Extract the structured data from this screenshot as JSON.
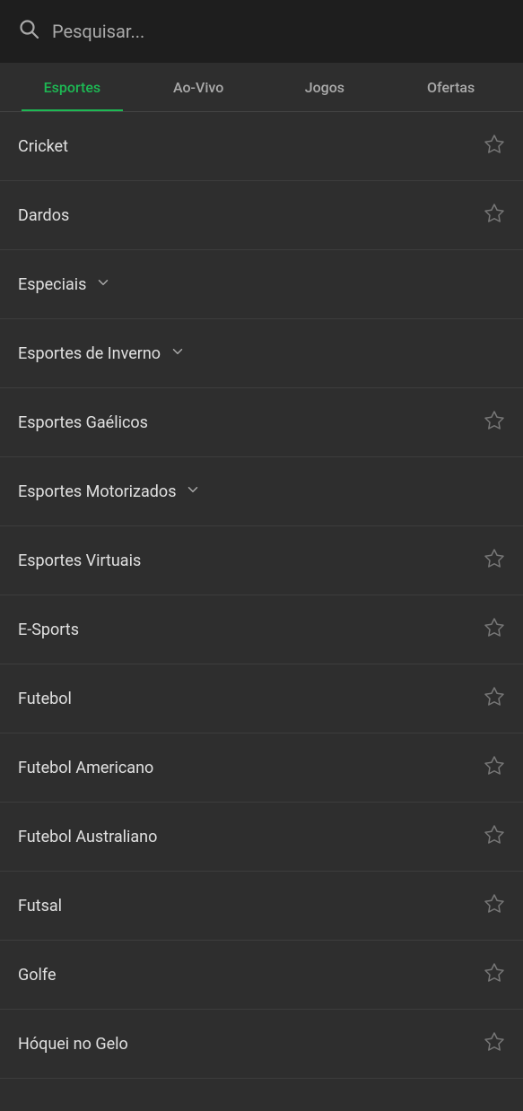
{
  "header": {
    "search_placeholder": "Pesquisar..."
  },
  "tabs": [
    {
      "id": "esportes",
      "label": "Esportes",
      "active": true
    },
    {
      "id": "ao-vivo",
      "label": "Ao-Vivo",
      "active": false
    },
    {
      "id": "jogos",
      "label": "Jogos",
      "active": false
    },
    {
      "id": "ofertas",
      "label": "Ofertas",
      "active": false
    }
  ],
  "sport_items": [
    {
      "id": "cricket",
      "label": "Cricket",
      "has_star": true,
      "has_chevron": false
    },
    {
      "id": "dardos",
      "label": "Dardos",
      "has_star": true,
      "has_chevron": false
    },
    {
      "id": "especiais",
      "label": "Especiais",
      "has_star": false,
      "has_chevron": true
    },
    {
      "id": "esportes-inverno",
      "label": "Esportes de Inverno",
      "has_star": false,
      "has_chevron": true
    },
    {
      "id": "esportes-gaelicos",
      "label": "Esportes Gaélicos",
      "has_star": true,
      "has_chevron": false
    },
    {
      "id": "esportes-motorizados",
      "label": "Esportes Motorizados",
      "has_star": false,
      "has_chevron": true
    },
    {
      "id": "esportes-virtuais",
      "label": "Esportes Virtuais",
      "has_star": true,
      "has_chevron": false
    },
    {
      "id": "e-sports",
      "label": "E-Sports",
      "has_star": true,
      "has_chevron": false
    },
    {
      "id": "futebol",
      "label": "Futebol",
      "has_star": true,
      "has_chevron": false
    },
    {
      "id": "futebol-americano",
      "label": "Futebol Americano",
      "has_star": true,
      "has_chevron": false
    },
    {
      "id": "futebol-australiano",
      "label": "Futebol Australiano",
      "has_star": true,
      "has_chevron": false
    },
    {
      "id": "futsal",
      "label": "Futsal",
      "has_star": true,
      "has_chevron": false
    },
    {
      "id": "golfe",
      "label": "Golfe",
      "has_star": true,
      "has_chevron": false
    },
    {
      "id": "hoquei-gelo",
      "label": "Hóquei no Gelo",
      "has_star": true,
      "has_chevron": false
    }
  ],
  "colors": {
    "active_tab": "#1db954",
    "background": "#2e2e2e",
    "header_bg": "#1e1e1e",
    "text": "#e0e0e0",
    "muted": "#aaaaaa",
    "divider": "#3d3d3d",
    "star": "#777777"
  }
}
